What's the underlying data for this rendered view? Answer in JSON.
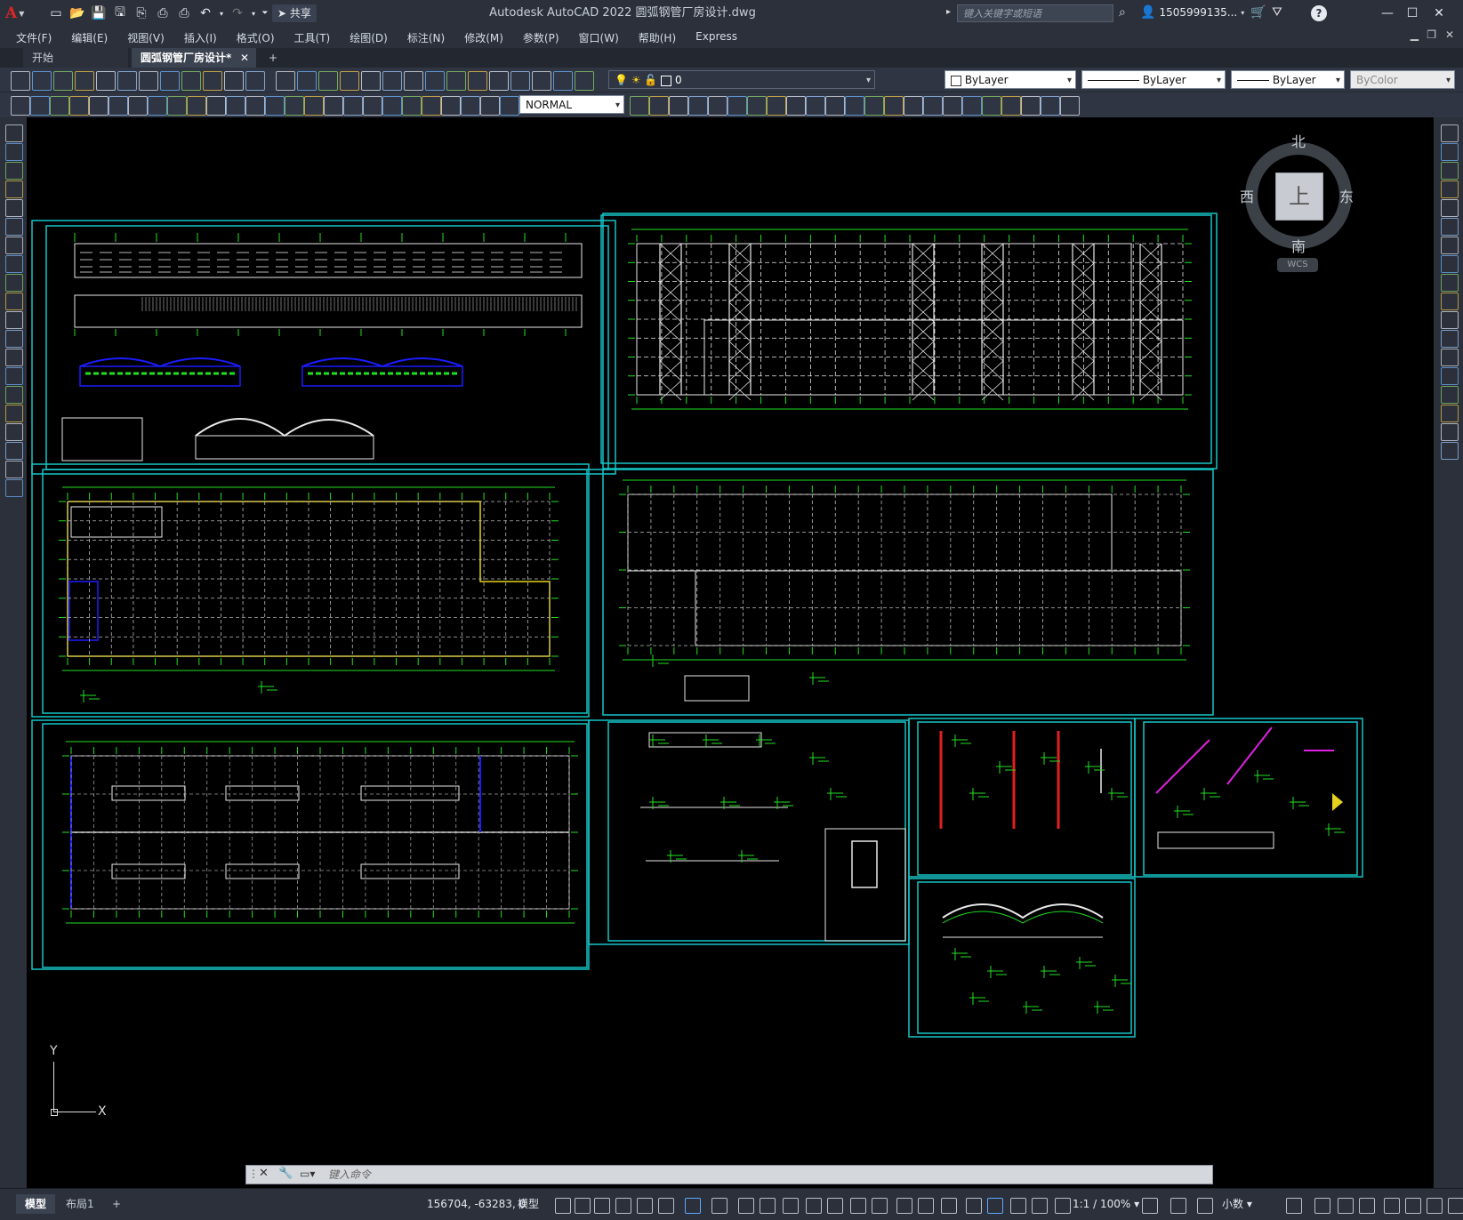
{
  "app": {
    "title": "Autodesk AutoCAD 2022    圆弧钢管厂房设计.dwg",
    "logo_letter": "A",
    "share_label": "共享",
    "search_placeholder": "键入关键字或短语",
    "user": "1505999135...",
    "help": "?"
  },
  "menu": {
    "items": [
      "文件(F)",
      "编辑(E)",
      "视图(V)",
      "插入(I)",
      "格式(O)",
      "工具(T)",
      "绘图(D)",
      "标注(N)",
      "修改(M)",
      "参数(P)",
      "窗口(W)",
      "帮助(H)",
      "Express"
    ]
  },
  "tabs": {
    "start": "开始",
    "active": "圆弧钢管厂房设计*",
    "add": "+"
  },
  "toolbar": {
    "layer_value": "0",
    "color": "ByLayer",
    "linetype": "ByLayer",
    "lineweight": "ByLayer",
    "plotstyle": "ByColor",
    "dimstyle": "NORMAL"
  },
  "viewcube": {
    "north": "北",
    "south": "南",
    "east": "东",
    "west": "西",
    "top": "上",
    "wcs": "WCS"
  },
  "ucs": {
    "x": "X",
    "y": "Y"
  },
  "command": {
    "placeholder": "键入命令"
  },
  "status": {
    "model_tab": "模型",
    "layout_tab": "布局1",
    "add_tab": "+",
    "coords": "156704, -63283, 0",
    "mode": "模型",
    "scale": "1:1 / 100%",
    "units": "小数"
  },
  "colors": {
    "canvas": "#000000",
    "viewport_border": "#16c5c8",
    "drawing_green": "#22e122",
    "drawing_white": "#e8e8e8",
    "drawing_blue": "#1c1cff",
    "drawing_yellow": "#e6d21e",
    "drawing_red": "#e02020",
    "drawing_magenta": "#e020e0"
  }
}
